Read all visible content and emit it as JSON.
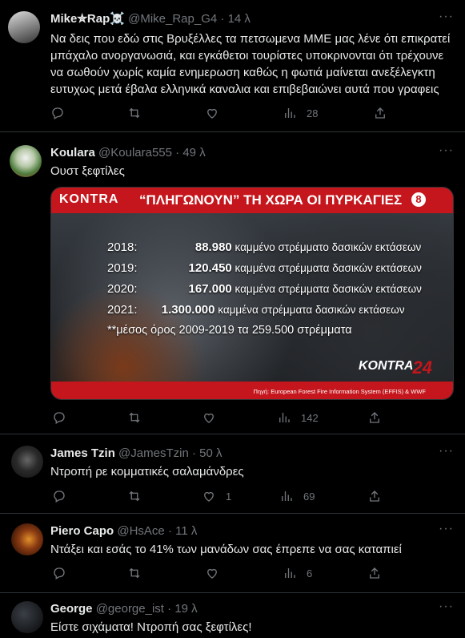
{
  "tweets": [
    {
      "name": "Mike✮Rap☠️",
      "handle": "@Mike_Rap_G4",
      "time": "14 λ",
      "text": "Να δεις που εδώ στις Βρυξέλλες τα πετσωμενα ΜΜΕ μας λένε ότι επικρατεί μπάχαλο ανοργανωσιά, και εγκάθετοι τουρίστες υποκρινονται ότι τρέχουνε να σωθούν χωρίς καμία ενημερωση καθώς η φωτιά μαίνεται ανεξέλεγκτη ευτυχως μετά έβαλα ελληνικά καναλια και επιβεβαιώνει αυτά που γραφεις",
      "replies": "",
      "retweets": "",
      "likes": "",
      "views": "28"
    },
    {
      "name": "Koulara",
      "handle": "@Koulara555",
      "time": "49 λ",
      "text": "Ουστ ξεφτίλες",
      "replies": "",
      "retweets": "",
      "likes": "",
      "views": "142",
      "media": {
        "logo": "KONTRA",
        "headline": "“ΠΛΗΓΩΝΟΥΝ” ΤΗ ΧΩΡΑ ΟΙ ΠΥΡΚΑΓΙΕΣ",
        "badge": "8",
        "rows": [
          {
            "year": "2018:",
            "value": "88.980",
            "desc": "καμμένο στρέμματο δασικών εκτάσεων"
          },
          {
            "year": "2019:",
            "value": "120.450",
            "desc": "καμμένα στρέμματα δασικών εκτάσεων"
          },
          {
            "year": "2020:",
            "value": "167.000",
            "desc": "καμμένα στρέμματα δασικών εκτάσεων"
          },
          {
            "year": "2021:",
            "value": "1.300.000",
            "desc": "καμμένα στρέμματα δασικών εκτάσεων"
          }
        ],
        "note": "**μέσος όρος 2009-2019 τα 259.500 στρέμματα",
        "brand_k": "KONTRA",
        "brand_n": "24",
        "source": "Πηγή: European Forest Fire Information System (EFFIS) & WWF"
      }
    },
    {
      "name": "James Tzin",
      "handle": "@JamesTzin",
      "time": "50 λ",
      "text": "Ντροπή ρε κομματικές σαλαμάνδρες",
      "replies": "",
      "retweets": "",
      "likes": "1",
      "views": "69"
    },
    {
      "name": "Piero Capo",
      "handle": "@HsAce",
      "time": "11 λ",
      "text": "Ντάξει και εσάς το 41% των μανάδων σας έπρεπε να σας καταπιεί",
      "replies": "",
      "retweets": "",
      "likes": "",
      "views": "6"
    },
    {
      "name": "George",
      "handle": "@george_ist",
      "time": "19 λ",
      "text": "Είστε σιχάματα! Ντροπή σας ξεφτίλες!"
    }
  ],
  "separator": "·",
  "more_glyph": "···",
  "colors": {
    "background": "#000000",
    "text": "#e7e9ea",
    "muted": "#71767b",
    "border": "#2f3336",
    "kontra_red": "#c4161c"
  }
}
